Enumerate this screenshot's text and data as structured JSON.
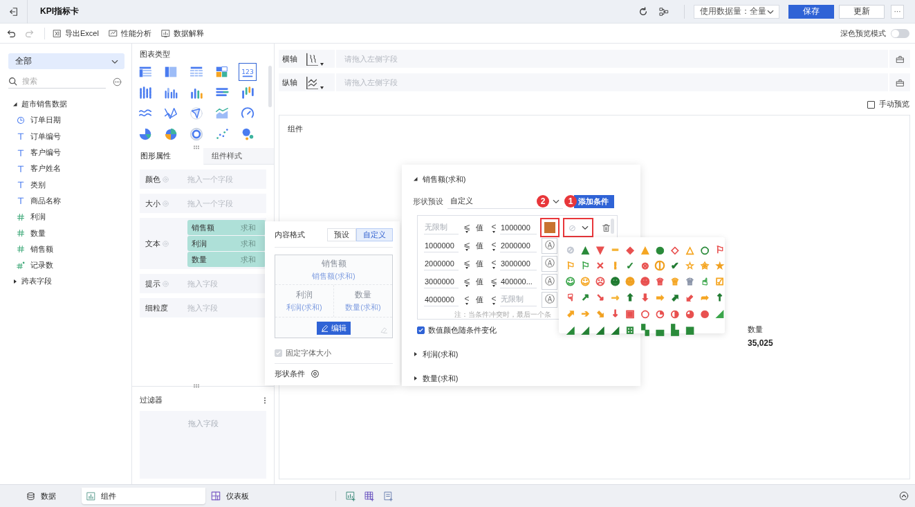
{
  "header": {
    "title": "KPI指标卡",
    "data_amount": "使用数据量：全量",
    "buttons": [
      {
        "label": "保存",
        "kind": "primary"
      },
      {
        "label": "更新",
        "kind": "default"
      }
    ],
    "more": "···"
  },
  "toolbar": {
    "undo_enabled": true,
    "redo_enabled": false,
    "items": [
      {
        "label": "导出Excel",
        "kind": "excel"
      },
      {
        "label": "性能分析",
        "kind": "performance"
      },
      {
        "label": "数据解释",
        "kind": "explain"
      }
    ],
    "dark_preview": {
      "label": "深色预览模式",
      "on": false
    }
  },
  "data_panel": {
    "scope": "全部",
    "search": {
      "placeholder": "搜索"
    },
    "tree": [
      {
        "label": "超市销售数据",
        "expanded": true,
        "children": [
          {
            "label": "订单日期",
            "kind": "date"
          },
          {
            "label": "订单编号",
            "kind": "text"
          },
          {
            "label": "客户编号",
            "kind": "text"
          },
          {
            "label": "客户姓名",
            "kind": "text"
          },
          {
            "label": "类别",
            "kind": "text"
          },
          {
            "label": "商品名称",
            "kind": "text"
          },
          {
            "label": "利润",
            "kind": "number"
          },
          {
            "label": "数量",
            "kind": "number"
          },
          {
            "label": "销售额",
            "kind": "number"
          },
          {
            "label": "记录数",
            "kind": "calc"
          }
        ]
      },
      {
        "label": "跨表字段",
        "expanded": false
      }
    ]
  },
  "chart_panel": {
    "title": "图表类型",
    "chart_types": [
      {
        "kind": "table",
        "selected": false
      },
      {
        "kind": "cross-table",
        "selected": false
      },
      {
        "kind": "detail-table",
        "selected": false
      },
      {
        "kind": "blocks",
        "selected": false
      },
      {
        "kind": "kpi",
        "glyph": "123",
        "selected": true
      },
      {
        "kind": "dot-bar",
        "selected": false
      },
      {
        "kind": "group-bar",
        "selected": false
      },
      {
        "kind": "color-bar",
        "selected": false
      },
      {
        "kind": "h-bar",
        "selected": false
      },
      {
        "kind": "waterfall",
        "selected": false
      },
      {
        "kind": "line",
        "selected": false
      },
      {
        "kind": "cross-line",
        "selected": false
      },
      {
        "kind": "radar",
        "selected": false
      },
      {
        "kind": "area",
        "selected": false
      },
      {
        "kind": "gauge",
        "selected": false
      },
      {
        "kind": "pie",
        "selected": false
      },
      {
        "kind": "rose",
        "selected": false
      },
      {
        "kind": "ring",
        "selected": false
      },
      {
        "kind": "scatter",
        "selected": false
      },
      {
        "kind": "bubble",
        "selected": false
      }
    ],
    "tabs": [
      {
        "label": "图形属性",
        "selected": true
      },
      {
        "label": "组件样式",
        "selected": false
      }
    ],
    "properties": [
      {
        "kind": "drop",
        "label": "颜色",
        "gear": true,
        "placeholder": "拖入一个字段"
      },
      {
        "kind": "drop",
        "label": "大小",
        "gear": true,
        "placeholder": "拖入一个字段"
      },
      {
        "kind": "fields",
        "label": "文本",
        "gear": true,
        "fields": [
          {
            "name": "销售额",
            "agg": "求和"
          },
          {
            "name": "利润",
            "agg": "求和"
          },
          {
            "name": "数量",
            "agg": "求和"
          }
        ]
      },
      {
        "kind": "drop",
        "label": "提示",
        "gear": true,
        "placeholder": "拖入字段"
      },
      {
        "kind": "drop",
        "label": "细粒度",
        "gear": false,
        "placeholder": "拖入字段"
      }
    ],
    "filter": {
      "title": "过滤器",
      "placeholder": "拖入字段"
    }
  },
  "design": {
    "axes": [
      {
        "label": "横轴",
        "kind": "x",
        "placeholder": "请拖入左侧字段"
      },
      {
        "label": "纵轴",
        "kind": "y",
        "placeholder": "请拖入左侧字段"
      }
    ],
    "manual_preview": {
      "label": "手动预览",
      "checked": false
    },
    "canvas": {
      "title": "组件",
      "metric": {
        "label": "数量",
        "value": "35,025"
      }
    }
  },
  "content_format": {
    "title": "内容格式",
    "modes": [
      {
        "label": "预设",
        "selected": false
      },
      {
        "label": "自定义",
        "selected": true
      }
    ],
    "preview": {
      "main": {
        "label": "销售额",
        "field": "销售额(求和)"
      },
      "subs": [
        {
          "label": "利润",
          "field": "利润(求和)"
        },
        {
          "label": "数量",
          "field": "数量(求和)"
        }
      ]
    },
    "edit": "编辑",
    "fixed_font": {
      "label": "固定字体大小",
      "checked": true,
      "disabled": true
    },
    "shape_condition": "形状条件"
  },
  "shape_panel": {
    "sections": [
      {
        "title": "销售额(求和)",
        "expanded": true,
        "preset_label": "形状预设",
        "preset": "自定义",
        "add": "添加条件",
        "callouts": [
          "2",
          "1"
        ],
        "conditions": [
          {
            "kind": "color",
            "min_placeholder": "无限制",
            "op1": "⩽",
            "var": "值",
            "op2": "<",
            "max": "1000000",
            "color": "#c8732f",
            "shape": "⊘",
            "highlighted": true
          },
          {
            "kind": "shape",
            "min": "1000000",
            "op1": "⩽",
            "var": "值",
            "op2": "<",
            "max": "2000000",
            "shape": "Ⓐ",
            "highlighted": false
          },
          {
            "kind": "shape",
            "min": "2000000",
            "op1": "⩽",
            "var": "值",
            "op2": "<",
            "max": "3000000",
            "shape": "Ⓐ",
            "highlighted": false
          },
          {
            "kind": "shape",
            "min": "3000000",
            "op1": "⩽",
            "var": "值",
            "op2": "⩽",
            "max": "400000...",
            "shape": "Ⓐ",
            "highlighted": false
          },
          {
            "kind": "shape",
            "min": "4000000",
            "op1": "<",
            "var": "值",
            "op2": "<",
            "max_placeholder": "无限制",
            "shape": "Ⓐ",
            "highlighted": false
          }
        ],
        "note": "注：当条件冲突时，最后一个条",
        "value_color": {
          "label": "数值颜色随条件变化",
          "checked": true
        }
      },
      {
        "title": "利润(求和)",
        "expanded": false
      },
      {
        "title": "数量(求和)",
        "expanded": false
      }
    ]
  },
  "shape_palette": [
    {
      "glyph": "⊘",
      "color": "#c3c8d2"
    },
    {
      "glyph": "▲",
      "color": "#2a8a3a"
    },
    {
      "glyph": "▼",
      "color": "#e8504f"
    },
    {
      "glyph": "━",
      "color": "#f5b335"
    },
    {
      "glyph": "◆",
      "color": "#e8504f"
    },
    {
      "glyph": "▲",
      "color": "#f5a623"
    },
    {
      "glyph": "●",
      "color": "#2a8a3a"
    },
    {
      "glyph": "◇",
      "color": "#e8504f"
    },
    {
      "glyph": "△",
      "color": "#f5a623"
    },
    {
      "glyph": "○",
      "color": "#2a8a3a"
    },
    {
      "glyph": "⚐",
      "color": "#e8504f"
    },
    {
      "glyph": "⚐",
      "color": "#f5a623"
    },
    {
      "glyph": "⚐",
      "color": "#3aa54a"
    },
    {
      "glyph": "✕",
      "color": "#e8504f"
    },
    {
      "glyph": "!",
      "color": "#f5a623"
    },
    {
      "glyph": "✓",
      "color": "#2a8a3a"
    },
    {
      "glyph": "⊗",
      "color": "#e8504f"
    },
    {
      "glyph": "ⓘ",
      "color": "#f0a020"
    },
    {
      "glyph": "✔",
      "color": "#1f7a30"
    },
    {
      "glyph": "☆",
      "color": "#f5a623"
    },
    {
      "glyph": "✬",
      "color": "#f5a623"
    },
    {
      "glyph": "★",
      "color": "#f0a020"
    },
    {
      "glyph": "☺",
      "color": "#3aa54a"
    },
    {
      "glyph": "☺",
      "color": "#f5a623"
    },
    {
      "glyph": "☹",
      "color": "#e8504f"
    },
    {
      "glyph": "☻",
      "color": "#1f7a30"
    },
    {
      "glyph": "☻",
      "color": "#f0a020"
    },
    {
      "glyph": "☻",
      "color": "#e8504f"
    },
    {
      "glyph": "♕",
      "color": "#e8504f"
    },
    {
      "glyph": "♕",
      "color": "#f5a623"
    },
    {
      "glyph": "♕",
      "color": "#8a94a8"
    },
    {
      "glyph": "☝",
      "color": "#3aa54a"
    },
    {
      "glyph": "☑",
      "color": "#f5a623"
    },
    {
      "glyph": "☟",
      "color": "#e8504f"
    },
    {
      "glyph": "↗",
      "color": "#2a8a3a"
    },
    {
      "glyph": "↘",
      "color": "#e8504f"
    },
    {
      "glyph": "→",
      "color": "#f5b335"
    },
    {
      "glyph": "⬆",
      "color": "#1f7a30"
    },
    {
      "glyph": "⬇",
      "color": "#e8504f"
    },
    {
      "glyph": "➡",
      "color": "#f5a623"
    },
    {
      "glyph": "⬈",
      "color": "#1f7a30"
    },
    {
      "glyph": "⬋",
      "color": "#e8504f"
    },
    {
      "glyph": "➦",
      "color": "#f5a623"
    },
    {
      "glyph": "↑",
      "color": "#1f7a30"
    },
    {
      "glyph": "⬈",
      "color": "#f5a623"
    },
    {
      "glyph": "➔",
      "color": "#f5a623"
    },
    {
      "glyph": "⬊",
      "color": "#f0a020"
    },
    {
      "glyph": "↓",
      "color": "#e8504f"
    },
    {
      "glyph": "▣",
      "color": "#e8504f"
    },
    {
      "glyph": "○",
      "color": "#e8504f"
    },
    {
      "glyph": "◔",
      "color": "#e8504f"
    },
    {
      "glyph": "◑",
      "color": "#e8504f"
    },
    {
      "glyph": "◕",
      "color": "#e8504f"
    },
    {
      "glyph": "●",
      "color": "#e8504f"
    },
    {
      "glyph": "◢",
      "color": "#3aa54a"
    },
    {
      "glyph": "◢",
      "color": "#2a8a3a"
    },
    {
      "glyph": "◢",
      "color": "#258035"
    },
    {
      "glyph": "◢",
      "color": "#207a30"
    },
    {
      "glyph": "◢",
      "color": "#1f7a30"
    },
    {
      "glyph": "⊞",
      "color": "#2a8a3a"
    },
    {
      "glyph": "▚",
      "color": "#2a8a3a"
    },
    {
      "glyph": "▄",
      "color": "#2a8a3a"
    },
    {
      "glyph": "▙",
      "color": "#2a8a3a"
    },
    {
      "glyph": "■",
      "color": "#2a8a3a"
    }
  ],
  "bottom_bar": {
    "tabs": [
      {
        "label": "数据",
        "kind": "data",
        "selected": false
      },
      {
        "label": "组件",
        "kind": "widget",
        "selected": true
      },
      {
        "label": "仪表板",
        "kind": "dashboard",
        "selected": false
      }
    ]
  }
}
